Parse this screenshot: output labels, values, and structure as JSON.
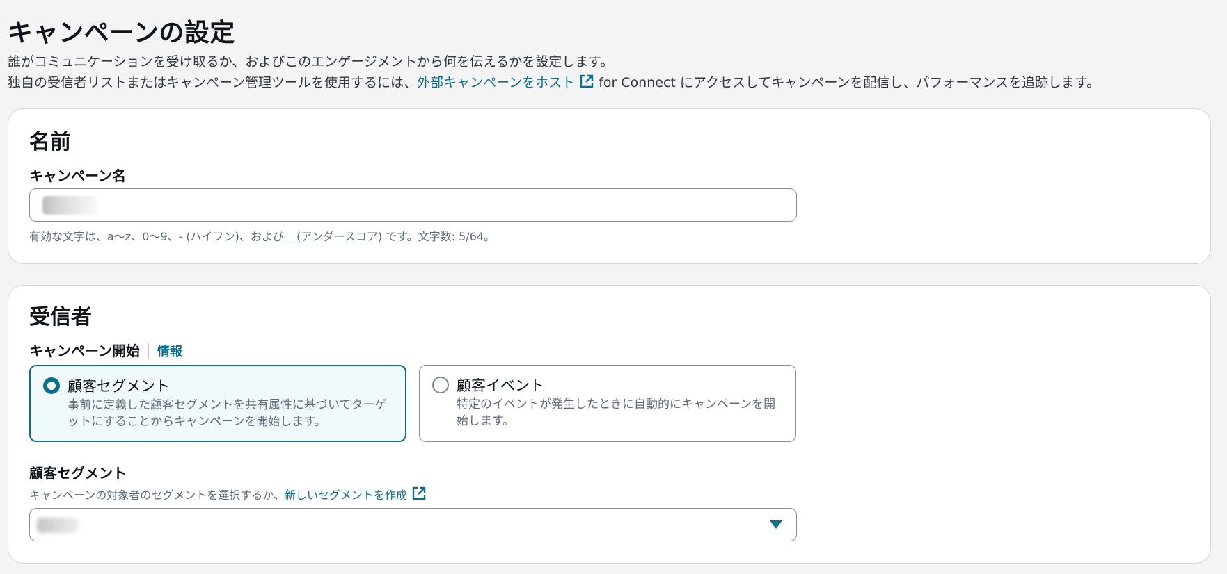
{
  "page": {
    "title": "キャンペーンの設定",
    "description_line1": "誰がコミュニケーションを受け取るか、およびこのエンゲージメントから何を伝えるかを設定します。",
    "description_line2_prefix": "独自の受信者リストまたはキャンペーン管理ツールを使用するには、",
    "description_line2_link": "外部キャンペーンをホスト",
    "description_line2_suffix": "for Connect にアクセスしてキャンペーンを配信し、パフォーマンスを追跡します。"
  },
  "name_section": {
    "heading": "名前",
    "field_label": "キャンペーン名",
    "field_value": "",
    "hint": "有効な文字は、a〜z、0〜9、- (ハイフン)、および _ (アンダースコア) です。文字数: 5/64。"
  },
  "recipients_section": {
    "heading": "受信者",
    "start_label": "キャンペーン開始",
    "info_link": "情報",
    "options": [
      {
        "title": "顧客セグメント",
        "description": "事前に定義した顧客セグメントを共有属性に基づいてターゲットにすることからキャンペーンを開始します。",
        "selected": true
      },
      {
        "title": "顧客イベント",
        "description": "特定のイベントが発生したときに自動的にキャンペーンを開始します。",
        "selected": false
      }
    ],
    "segment_label": "顧客セグメント",
    "segment_hint": "キャンペーンの対象者のセグメントを選択するか、",
    "segment_link": "新しいセグメントを作成",
    "segment_value": ""
  },
  "colors": {
    "accent": "#0b6f8e",
    "page_background": "#f4f4f4",
    "panel_background": "#ffffff"
  },
  "icons": {
    "external_link": "external-link-icon",
    "dropdown": "caret-down-icon"
  }
}
